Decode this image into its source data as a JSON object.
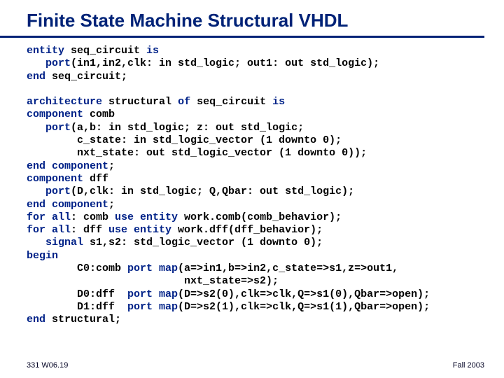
{
  "title": "Finite State Machine Structural VHDL",
  "code": {
    "l01a": "entity",
    "l01b": " seq_circuit ",
    "l01c": "is",
    "l02a": "   port",
    "l02b": "(in1,in2,clk: in std_logic; out1: out std_logic);",
    "l03a": "end",
    "l03b": " seq_circuit;",
    "l05a": "architecture",
    "l05b": " structural ",
    "l05c": "of",
    "l05d": " seq_circuit ",
    "l05e": "is",
    "l06a": "component",
    "l06b": " comb",
    "l07a": "   port",
    "l07b": "(a,b: in std_logic; z: out std_logic;",
    "l08": "        c_state: in std_logic_vector (1 downto 0);",
    "l09": "        nxt_state: out std_logic_vector (1 downto 0));",
    "l10a": "end component",
    "l10b": ";",
    "l11a": "component",
    "l11b": " dff",
    "l12a": "   port",
    "l12b": "(D,clk: in std_logic; Q,Qbar: out std_logic);",
    "l13a": "end component",
    "l13b": ";",
    "l14a": "for all",
    "l14b": ": comb ",
    "l14c": "use entity",
    "l14d": " work.comb(comb_behavior);",
    "l15a": "for all",
    "l15b": ": dff ",
    "l15c": "use entity",
    "l15d": " work.dff(dff_behavior);",
    "l16a": "   signal",
    "l16b": " s1,s2: std_logic_vector (1 downto 0);",
    "l17": "begin",
    "l18a": "        C0:comb ",
    "l18b": "port map",
    "l18c": "(a=>in1,b=>in2,c_state=>s1,z=>out1,",
    "l19": "                         nxt_state=>s2);",
    "l20a": "        D0:dff  ",
    "l20b": "port map",
    "l20c": "(D=>s2(0),clk=>clk,Q=>s1(0),Qbar=>open);",
    "l21a": "        D1:dff  ",
    "l21b": "port map",
    "l21c": "(D=>s2(1),clk=>clk,Q=>s1(1),Qbar=>open);",
    "l22a": "end",
    "l22b": " structural;"
  },
  "footer": {
    "left": "331 W06.19",
    "right": "Fall 2003"
  }
}
